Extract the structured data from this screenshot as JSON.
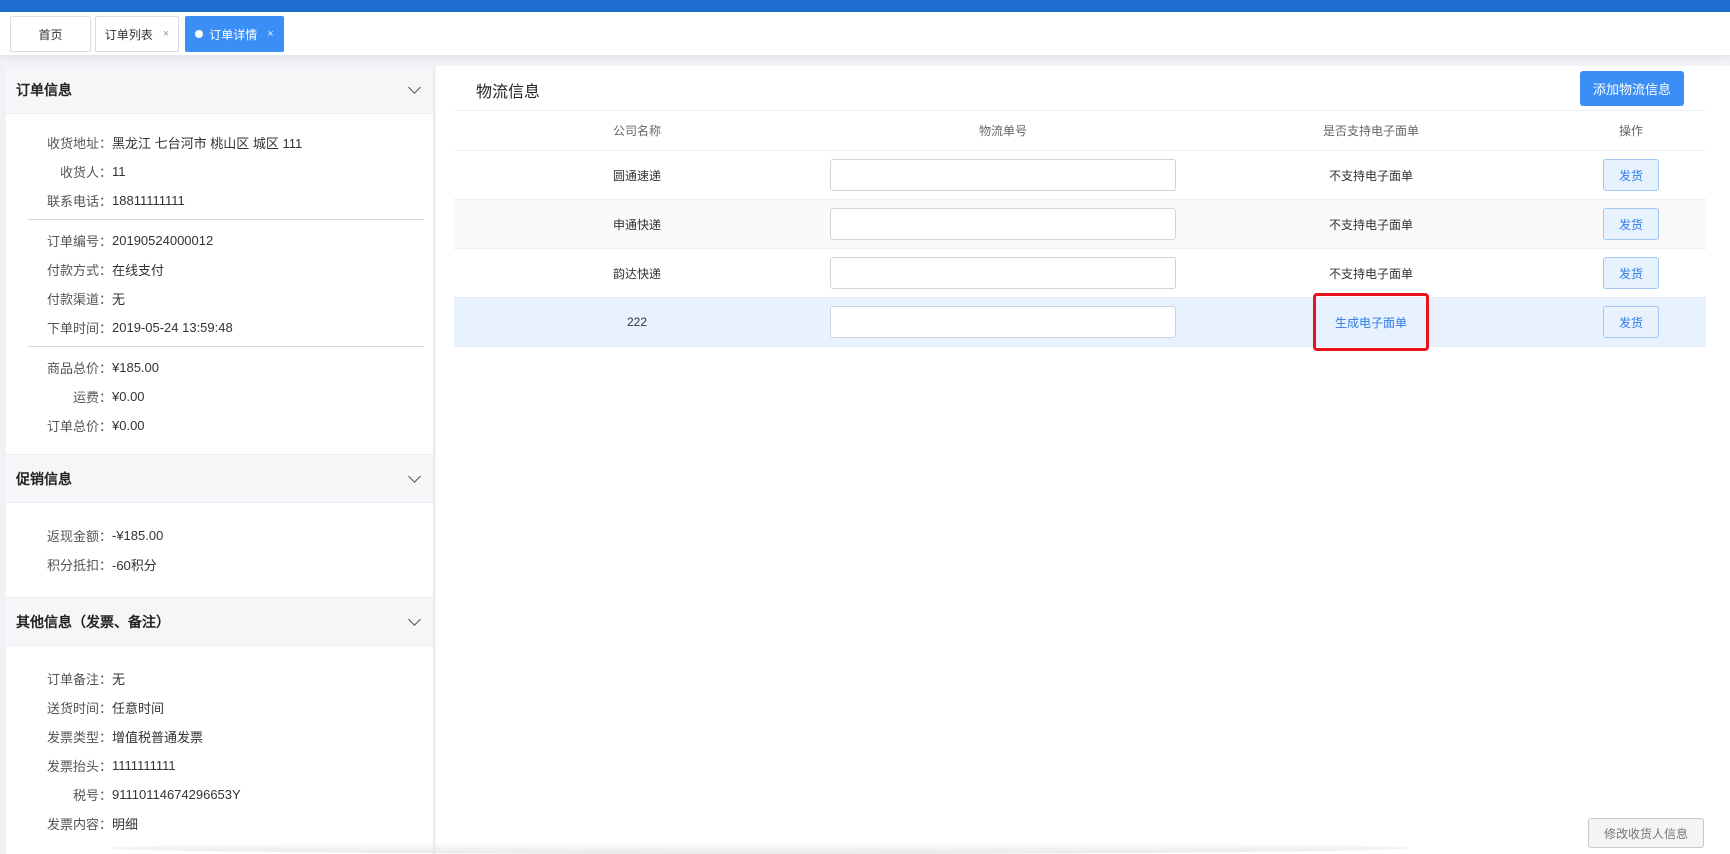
{
  "tabs": [
    {
      "label": "首页"
    },
    {
      "label": "订单列表",
      "close": "×"
    },
    {
      "label": "订单详情",
      "close": "×"
    }
  ],
  "order_info": {
    "title": "订单信息",
    "group1": [
      {
        "label": "收货地址：",
        "value": "黑龙江 七台河市 桃山区 城区 111"
      },
      {
        "label": "收货人：",
        "value": "11"
      },
      {
        "label": "联系电话：",
        "value": "18811111111"
      }
    ],
    "group2": [
      {
        "label": "订单编号：",
        "value": "20190524000012"
      },
      {
        "label": "付款方式：",
        "value": "在线支付"
      },
      {
        "label": "付款渠道：",
        "value": "无"
      },
      {
        "label": "下单时间：",
        "value": "2019-05-24 13:59:48"
      }
    ],
    "group3": [
      {
        "label": "商品总价：",
        "value": "¥185.00"
      },
      {
        "label": "运费：",
        "value": "¥0.00"
      },
      {
        "label": "订单总价：",
        "value": "¥0.00"
      }
    ]
  },
  "promo_info": {
    "title": "促销信息",
    "rows": [
      {
        "label": "返现金额：",
        "value": "-¥185.00"
      },
      {
        "label": "积分抵扣：",
        "value": "-60积分"
      }
    ]
  },
  "other_info": {
    "title": "其他信息（发票、备注）",
    "rows": [
      {
        "label": "订单备注：",
        "value": "无"
      },
      {
        "label": "送货时间：",
        "value": "任意时间"
      },
      {
        "label": "发票类型：",
        "value": "增值税普通发票"
      },
      {
        "label": "发票抬头：",
        "value": "1111111111"
      },
      {
        "label": "税号：",
        "value": "91110114674296653Y"
      },
      {
        "label": "发票内容：",
        "value": "明细"
      }
    ]
  },
  "logistics": {
    "title": "物流信息",
    "add_button": "添加物流信息",
    "columns": [
      "公司名称",
      "物流单号",
      "是否支持电子面单",
      "操作"
    ],
    "rows": [
      {
        "company": "圆通速递",
        "tracking": "",
        "esupport": "不支持电子面单",
        "action": "发货"
      },
      {
        "company": "申通快递",
        "tracking": "",
        "esupport": "不支持电子面单",
        "action": "发货"
      },
      {
        "company": "韵达快递",
        "tracking": "",
        "esupport": "不支持电子面单",
        "action": "发货"
      },
      {
        "company": "222",
        "tracking": "",
        "esupport": "生成电子面单",
        "action": "发货"
      }
    ],
    "edit_button": "修改收货人信息"
  },
  "colors": {
    "primary": "#3a8ef6",
    "highlight": "#e6141a",
    "topbar": "#1e6fd0"
  }
}
